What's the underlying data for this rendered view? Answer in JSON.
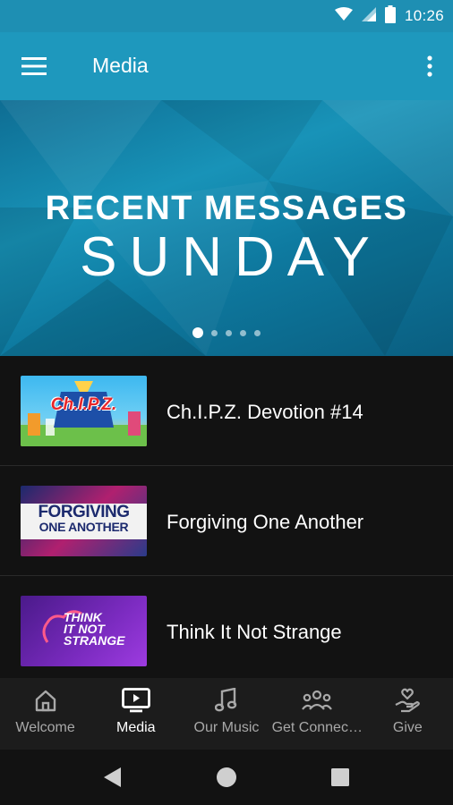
{
  "status_bar": {
    "time": "10:26"
  },
  "app_bar": {
    "title": "Media"
  },
  "banner": {
    "line1": "RECENT MESSAGES",
    "line2": "SUNDAY",
    "dots": [
      {
        "active": true
      },
      {
        "active": false
      },
      {
        "active": false
      },
      {
        "active": false
      },
      {
        "active": false
      }
    ]
  },
  "items": [
    {
      "title": "Ch.I.P.Z. Devotion #14",
      "thumb_text": "Ch.I.P.Z."
    },
    {
      "title": "Forgiving One Another",
      "thumb_text_a": "FORGIVING",
      "thumb_text_b": "ONE ANOTHER"
    },
    {
      "title": "Think It Not Strange",
      "thumb_text": "THINK IT NOT STRANGE",
      "thumb_lines": [
        "THINK",
        "IT NOT",
        "STRANGE"
      ]
    }
  ],
  "bottom_nav": [
    {
      "label": "Welcome",
      "icon": "home-icon",
      "active": false
    },
    {
      "label": "Media",
      "icon": "tv-play-icon",
      "active": true
    },
    {
      "label": "Our Music",
      "icon": "music-note-icon",
      "active": false
    },
    {
      "label": "Get Connec…",
      "icon": "people-group-icon",
      "active": false
    },
    {
      "label": "Give",
      "icon": "heart-hand-icon",
      "active": false
    }
  ],
  "colors": {
    "status_bar": "#1e8fb3",
    "app_bar": "#1e98bd",
    "background": "#121212",
    "nav_background": "#1c1c1c",
    "nav_inactive": "#a8a8a8"
  }
}
